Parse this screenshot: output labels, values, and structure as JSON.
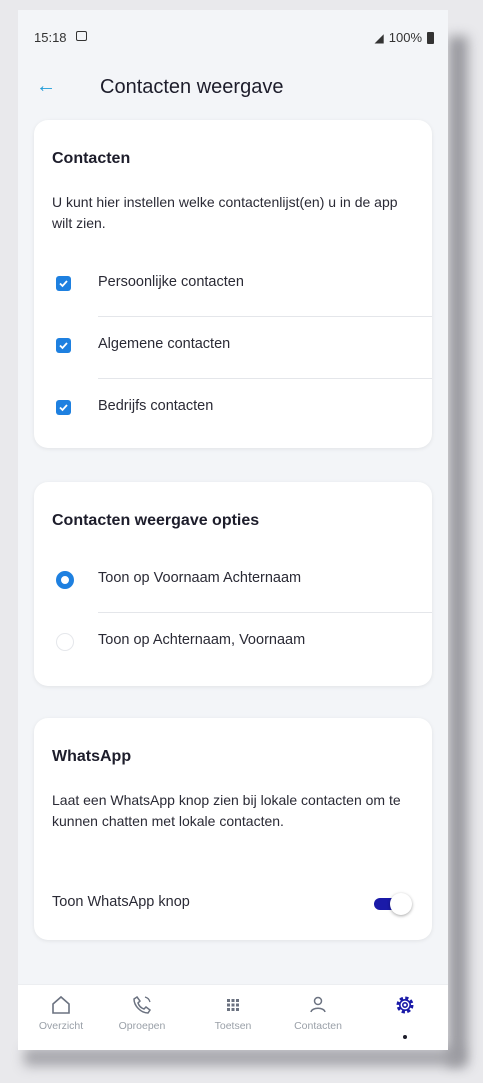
{
  "status_bar": {
    "time": "15:18",
    "battery": "100%"
  },
  "header": {
    "title": "Contacten weergave"
  },
  "contacts_card": {
    "title": "Contacten",
    "description": "U kunt hier instellen welke contactenlijst(en) u in de app wilt zien.",
    "options": [
      {
        "label": "Persoonlijke contacten",
        "checked": true
      },
      {
        "label": "Algemene contacten",
        "checked": true
      },
      {
        "label": "Bedrijfs contacten",
        "checked": true
      }
    ]
  },
  "display_card": {
    "title": "Contacten weergave opties",
    "options": [
      {
        "label": "Toon op Voornaam Achternaam",
        "selected": true
      },
      {
        "label": "Toon op Achternaam, Voornaam",
        "selected": false
      }
    ]
  },
  "whatsapp_card": {
    "title": "WhatsApp",
    "description": "Laat een WhatsApp knop zien bij lokale contacten om te kunnen chatten met lokale contacten.",
    "toggle_label": "Toon WhatsApp knop",
    "toggle_on": true
  },
  "bottom_nav": {
    "items": [
      {
        "label": "Overzicht",
        "icon": "home-icon"
      },
      {
        "label": "Oproepen",
        "icon": "phone-icon"
      },
      {
        "label": "Toetsen",
        "icon": "keypad-icon"
      },
      {
        "label": "Contacten",
        "icon": "person-icon"
      },
      {
        "label": "",
        "icon": "gear-icon",
        "active": true
      }
    ]
  },
  "colors": {
    "accent": "#1e80e0",
    "toggle": "#1a1aa8",
    "back_arrow": "#1f9bd8",
    "background": "#f3f5f8"
  }
}
